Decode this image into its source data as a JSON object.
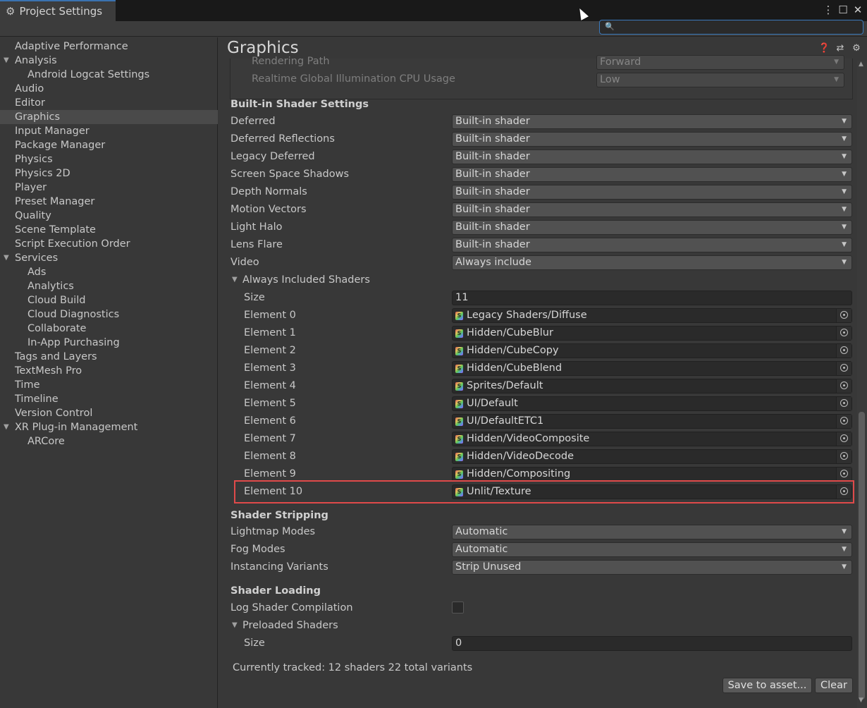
{
  "window": {
    "tab_title": "Project Settings",
    "gear_icon": "gear-icon",
    "menu_icon": "more-vertical-icon",
    "maximize_icon": "maximize-icon",
    "close_icon": "close-icon"
  },
  "search": {
    "placeholder": "",
    "value": ""
  },
  "sidebar": {
    "items": [
      {
        "label": "Adaptive Performance",
        "level": 0
      },
      {
        "label": "Analysis",
        "level": 0,
        "expanded": true
      },
      {
        "label": "Android Logcat Settings",
        "level": 1
      },
      {
        "label": "Audio",
        "level": 0
      },
      {
        "label": "Editor",
        "level": 0
      },
      {
        "label": "Graphics",
        "level": 0,
        "selected": true
      },
      {
        "label": "Input Manager",
        "level": 0
      },
      {
        "label": "Package Manager",
        "level": 0
      },
      {
        "label": "Physics",
        "level": 0
      },
      {
        "label": "Physics 2D",
        "level": 0
      },
      {
        "label": "Player",
        "level": 0
      },
      {
        "label": "Preset Manager",
        "level": 0
      },
      {
        "label": "Quality",
        "level": 0
      },
      {
        "label": "Scene Template",
        "level": 0
      },
      {
        "label": "Script Execution Order",
        "level": 0
      },
      {
        "label": "Services",
        "level": 0,
        "expanded": true
      },
      {
        "label": "Ads",
        "level": 1
      },
      {
        "label": "Analytics",
        "level": 1
      },
      {
        "label": "Cloud Build",
        "level": 1
      },
      {
        "label": "Cloud Diagnostics",
        "level": 1
      },
      {
        "label": "Collaborate",
        "level": 1
      },
      {
        "label": "In-App Purchasing",
        "level": 1
      },
      {
        "label": "Tags and Layers",
        "level": 0
      },
      {
        "label": "TextMesh Pro",
        "level": 0
      },
      {
        "label": "Time",
        "level": 0
      },
      {
        "label": "Timeline",
        "level": 0
      },
      {
        "label": "Version Control",
        "level": 0
      },
      {
        "label": "XR Plug-in Management",
        "level": 0,
        "expanded": true
      },
      {
        "label": "ARCore",
        "level": 1
      }
    ]
  },
  "main": {
    "title": "Graphics",
    "top": {
      "rendering_path_label": "Rendering Path",
      "rendering_path_value": "Forward",
      "realtime_gi_label": "Realtime Global Illumination CPU Usage",
      "realtime_gi_value": "Low"
    },
    "builtin": {
      "header": "Built-in Shader Settings",
      "rows": [
        {
          "label": "Deferred",
          "value": "Built-in shader"
        },
        {
          "label": "Deferred Reflections",
          "value": "Built-in shader"
        },
        {
          "label": "Legacy Deferred",
          "value": "Built-in shader"
        },
        {
          "label": "Screen Space Shadows",
          "value": "Built-in shader"
        },
        {
          "label": "Depth Normals",
          "value": "Built-in shader"
        },
        {
          "label": "Motion Vectors",
          "value": "Built-in shader"
        },
        {
          "label": "Light Halo",
          "value": "Built-in shader"
        },
        {
          "label": "Lens Flare",
          "value": "Built-in shader"
        },
        {
          "label": "Video",
          "value": "Always include"
        }
      ]
    },
    "always_included": {
      "header": "Always Included Shaders",
      "size_label": "Size",
      "size_value": "11",
      "elements": [
        {
          "label": "Element 0",
          "value": "Legacy Shaders/Diffuse"
        },
        {
          "label": "Element 1",
          "value": "Hidden/CubeBlur"
        },
        {
          "label": "Element 2",
          "value": "Hidden/CubeCopy"
        },
        {
          "label": "Element 3",
          "value": "Hidden/CubeBlend"
        },
        {
          "label": "Element 4",
          "value": "Sprites/Default"
        },
        {
          "label": "Element 5",
          "value": "UI/Default"
        },
        {
          "label": "Element 6",
          "value": "UI/DefaultETC1"
        },
        {
          "label": "Element 7",
          "value": "Hidden/VideoComposite"
        },
        {
          "label": "Element 8",
          "value": "Hidden/VideoDecode"
        },
        {
          "label": "Element 9",
          "value": "Hidden/Compositing"
        },
        {
          "label": "Element 10",
          "value": "Unlit/Texture"
        }
      ]
    },
    "stripping": {
      "header": "Shader Stripping",
      "rows": [
        {
          "label": "Lightmap Modes",
          "value": "Automatic"
        },
        {
          "label": "Fog Modes",
          "value": "Automatic"
        },
        {
          "label": "Instancing Variants",
          "value": "Strip Unused"
        }
      ]
    },
    "loading": {
      "header": "Shader Loading",
      "log_label": "Log Shader Compilation",
      "log_checked": false,
      "preloaded_header": "Preloaded Shaders",
      "size_label": "Size",
      "size_value": "0"
    },
    "tracked_text": "Currently tracked: 12 shaders 22 total variants",
    "buttons": {
      "save": "Save to asset...",
      "clear": "Clear"
    }
  },
  "colors": {
    "highlight": "#e04a4a",
    "accent": "#3a72b0"
  }
}
